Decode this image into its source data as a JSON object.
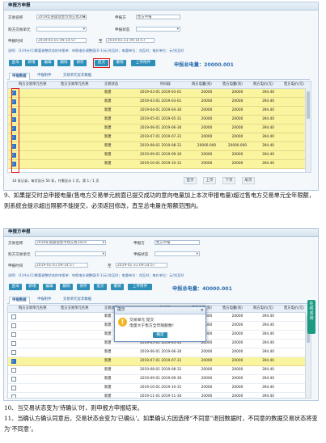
{
  "panel1": {
    "title": "申报方申报",
    "form": {
      "trade_name_label": "交易名称",
      "trade_name_value": "2019年省级现金市场交易2019",
      "role_label": "申报方",
      "role_value": "售方申报",
      "buyer_unit_label": "购方交易单元",
      "trade_status_label": "申报状态",
      "declare_time_label": "申报时间",
      "time_from": "2019-01-01 09:14:57",
      "time_sep": "至",
      "time_to": "2019-01-31 09:14:57"
    },
    "hint": "说明：(1)共计(1)需要调整状态的申报单：申报电价调整值(0-1)元/兆瓦时；电量单位：兆瓦时；电价单位：元/兆瓦时",
    "buttons": [
      "查询",
      "新增",
      "编辑",
      "删除",
      "保存",
      "提交",
      "撤销",
      "上传附件"
    ],
    "total_label": "申报总电量：20000.001",
    "tabs": [
      "申报数据",
      "申报附件",
      "交易单元近年数据"
    ],
    "columns": [
      "购方交易单元名称",
      "售方交易单元名称",
      "交易状态",
      "时间段",
      "购方电量(兆)",
      "售方电量(兆)",
      "购方电价(元)",
      "售方电价(元)"
    ],
    "rows": [
      {
        "status": "新建",
        "time": "2019-03-01 2019-03-01",
        "bq": "20000",
        "sq": "20000",
        "bp": "394.40",
        "sp": ""
      },
      {
        "status": "新建",
        "time": "2019-03-01 2019-03-01",
        "bq": "20000",
        "sq": "20000",
        "bp": "394.40",
        "sp": ""
      },
      {
        "status": "新建",
        "time": "2019-04-01 2019-04-30",
        "bq": "20000",
        "sq": "20000",
        "bp": "394.40",
        "sp": ""
      },
      {
        "status": "新建",
        "time": "2019-05-01 2019-05-31",
        "bq": "20000",
        "sq": "20000",
        "bp": "394.40",
        "sp": ""
      },
      {
        "status": "新建",
        "time": "2019-06-01 2019-06-30",
        "bq": "20000",
        "sq": "20000",
        "bp": "394.40",
        "sp": ""
      },
      {
        "status": "新建",
        "time": "2019-07-01 2019-07-31",
        "bq": "20000",
        "sq": "20000",
        "bp": "394.40",
        "sp": ""
      },
      {
        "status": "新建",
        "time": "2019-08-01 2019-08-31",
        "bq": "20000.000",
        "sq": "20000.000",
        "bp": "394.40",
        "sp": ""
      },
      {
        "status": "新建",
        "time": "2019-09-01 2019-09-30",
        "bq": "20000",
        "sq": "20000",
        "bp": "394.40",
        "sp": ""
      },
      {
        "status": "新建",
        "time": "2019-10-01 2019-10-31",
        "bq": "20000",
        "sq": "20000",
        "bp": "394.40",
        "sp": ""
      }
    ],
    "pager": "10 条记录，每页显示 50 条，共需显示 1 页，第 1 / 1 页",
    "pager_buttons": [
      "首页",
      "上页",
      "下页",
      "尾页"
    ]
  },
  "paragraph1": "9、如果提交时总申报电量(售电方交易单元前面已提交成功的意向电量加上本次申报电量)超过售电方交易单元全年限额，则系统会提示超出限额不能提交，必须返回修改，直至总电量在限额范围内。",
  "panel2": {
    "title": "申报方申报",
    "form": {
      "trade_name_label": "交易名称",
      "trade_name_value": "2019年省级现金市场交易2019",
      "role_label": "申报方",
      "role_value": "售方申报",
      "buyer_unit_label": "购方交易单元",
      "trade_status_label": "申报状态",
      "declare_time_label": "申报时间",
      "time_from": "2019-01-01 09:14:57",
      "time_sep": "至",
      "time_to": "2019-01-31 09:14:57"
    },
    "hint": "说明：(1)共计(1)需要调整状态的申报单：申报电价调整值(0-1)元/兆瓦时；电量单位：兆瓦时；电价单位：元/兆瓦时",
    "buttons": [
      "查询",
      "新增",
      "编辑",
      "删除",
      "保存",
      "提交",
      "撤销",
      "上传附件"
    ],
    "total_label": "申报总电量：40000.001",
    "tabs": [
      "申报数据",
      "申报附件",
      "交易单元近年数据"
    ],
    "columns": [
      "购方交易单元名称",
      "售方交易单元名称",
      "交易状态",
      "时间段",
      "购方电量(兆)",
      "售方电量(兆)",
      "购方电价(元)",
      "售方电价(元)"
    ],
    "rows": [
      {
        "status": "新建",
        "time": "2019-03-01 2019-03-31",
        "bq": "20000",
        "sq": "20000",
        "bp": "394.40",
        "sp": ""
      },
      {
        "status": "新建",
        "time": "2019-03-01 2019-03-31",
        "bq": "20000",
        "sq": "20000",
        "bp": "394.40",
        "sp": ""
      },
      {
        "status": "新建",
        "time": "2019-04-01 2019-04-30",
        "bq": "20000",
        "sq": "20000",
        "bp": "394.40",
        "sp": ""
      },
      {
        "status": "新建",
        "time": "2019-05-01 2019-05-31",
        "bq": "20000",
        "sq": "20000",
        "bp": "394.40",
        "sp": ""
      },
      {
        "status": "新建",
        "time": "2019-06-01 2019-06-30",
        "bq": "20000",
        "sq": "20000",
        "bp": "394.40",
        "sp": ""
      },
      {
        "status": "新建",
        "time": "2019-07-01 2019-07-31",
        "bq": "20000",
        "sq": "20000",
        "bp": "394.40",
        "sp": ""
      },
      {
        "status": "新建",
        "time": "2019-08-01 2019-08-31",
        "bq": "20000",
        "sq": "20000",
        "bp": "394.40",
        "sp": ""
      },
      {
        "status": "新建",
        "time": "2019-09-01 2019-09-30",
        "bq": "20000",
        "sq": "20000",
        "bp": "394.40",
        "sp": ""
      },
      {
        "status": "新建",
        "time": "2019-10-01 2019-10-31",
        "bq": "20000",
        "sq": "20000",
        "bp": "394.40",
        "sp": ""
      },
      {
        "status": "新建",
        "time": "2019-11-01 2019-11-30",
        "bq": "20000",
        "sq": "20000",
        "bp": "394.40",
        "sp": ""
      }
    ],
    "dialog": {
      "title": "提示",
      "message_line1": "交易单元                                        提交",
      "message_line2": "电量大于售方全年限额数！",
      "ok_label": "确定",
      "close_glyph": "×"
    },
    "side_widget": "在线咨询"
  },
  "paragraph2": "10、当交易状态变为‘待确认’时，则申报方申报结束。",
  "paragraph3": "11、当确认方确认同意后，交易状态会变为‘已确认’。如果确认方因选择“不同意”退回数据时，不同意的数据交易状态将变为‘不同意’。"
}
